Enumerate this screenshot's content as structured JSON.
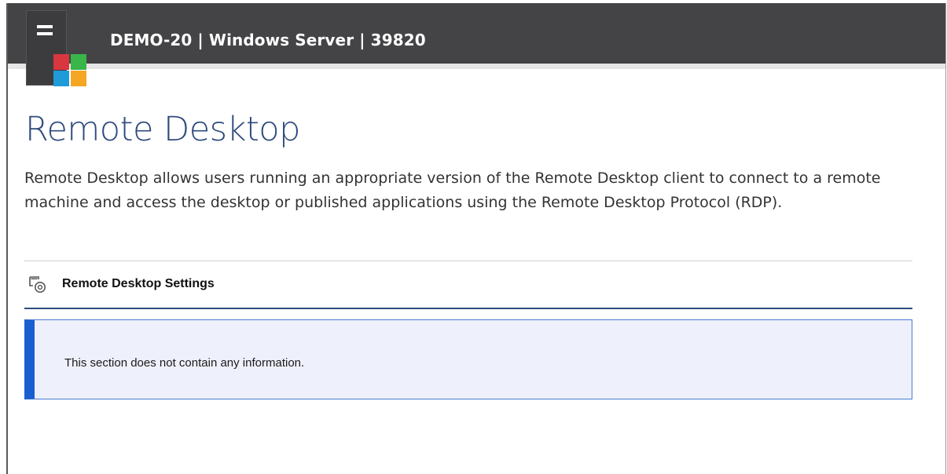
{
  "header": {
    "title": "DEMO-20 | Windows Server | 39820",
    "logo_icon": "server-windows-logo-icon",
    "background_color": "#444446"
  },
  "page": {
    "title": "Remote Desktop",
    "description": "Remote Desktop allows users running an appropriate version of the Remote Desktop client to connect to a remote machine and access the desktop or published applications using the Remote Desktop Protocol (RDP)."
  },
  "section": {
    "icon": "settings-window-icon",
    "title": "Remote Desktop Settings",
    "empty_message": "This section does not contain any information."
  },
  "colors": {
    "title_blue": "#2e4a7d",
    "accent_blue": "#1a5fcf",
    "info_background": "#eef0fb",
    "logo_red": "#d9363e",
    "logo_green": "#39b54a",
    "logo_blue": "#1f9bd7",
    "logo_orange": "#f5a623"
  }
}
